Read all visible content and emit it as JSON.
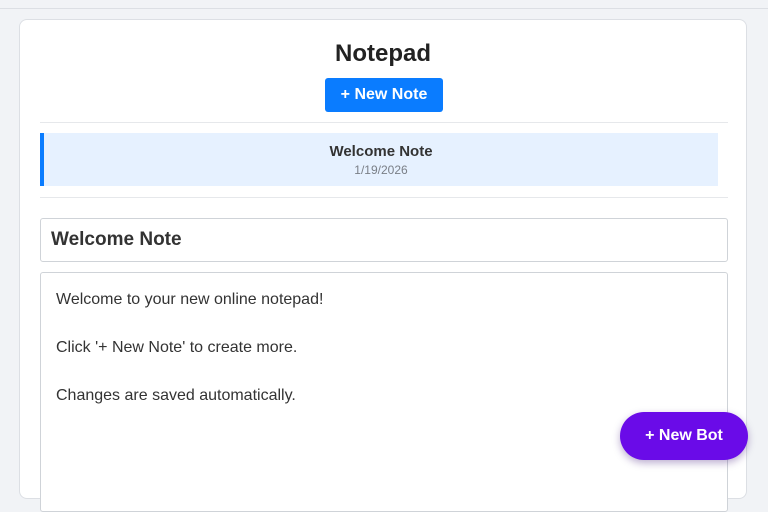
{
  "app": {
    "title": "Notepad",
    "new_note_label": "+ New Note"
  },
  "notes_list": [
    {
      "title": "Welcome Note",
      "date": "1/19/2026",
      "selected": true
    }
  ],
  "editor": {
    "title_value": "Welcome Note",
    "body_value": "Welcome to your new online notepad!\n\nClick '+ New Note' to create more.\n\nChanges are saved automatically."
  },
  "fab": {
    "label": "+ New Bot"
  },
  "colors": {
    "accent": "#0a7cff",
    "selected_bg": "#e6f1ff",
    "fab": "#6a0be8",
    "page_bg": "#f1f3f6"
  }
}
